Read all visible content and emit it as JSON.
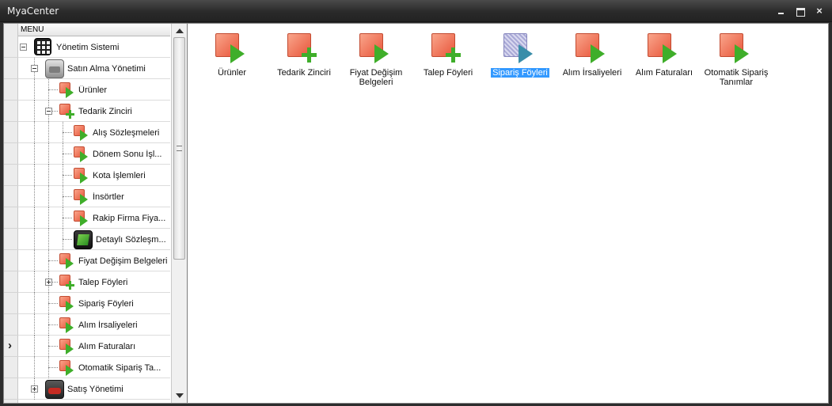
{
  "window": {
    "title": "MyaCenter",
    "minimize_label": "",
    "maximize_label": "",
    "close_label": "×"
  },
  "tree": {
    "header": "MENU",
    "active_row_index": 14,
    "rows": [
      {
        "label": "Yönetim Sistemi",
        "icon": "grid-app-icon"
      },
      {
        "label": "Satın Alma Yönetimi",
        "icon": "truck-app-icon"
      },
      {
        "label": "Ürünler",
        "icon": "document-play-icon"
      },
      {
        "label": "Tedarik Zinciri",
        "icon": "document-plus-icon"
      },
      {
        "label": "Alış Sözleşmeleri",
        "icon": "document-play-icon"
      },
      {
        "label": "Dönem Sonu İşl...",
        "icon": "document-play-icon"
      },
      {
        "label": "Kota İşlemleri",
        "icon": "document-play-icon"
      },
      {
        "label": "İnsörtler",
        "icon": "document-play-icon"
      },
      {
        "label": "Rakip Firma Fiya...",
        "icon": "document-play-icon"
      },
      {
        "label": "Detaylı Sözleşm...",
        "icon": "excel-app-icon"
      },
      {
        "label": "Fiyat Değişim Belgeleri",
        "icon": "document-play-icon"
      },
      {
        "label": "Talep Föyleri",
        "icon": "document-plus-icon"
      },
      {
        "label": "Sipariş Föyleri",
        "icon": "document-play-icon"
      },
      {
        "label": "Alım İrsaliyeleri",
        "icon": "document-play-icon"
      },
      {
        "label": "Alım Faturaları",
        "icon": "document-play-icon"
      },
      {
        "label": "Otomatik Sipariş Ta...",
        "icon": "document-play-icon"
      },
      {
        "label": "Satış Yönetimi",
        "icon": "car-app-icon"
      }
    ]
  },
  "tiles": [
    {
      "label": "Ürünler",
      "icon": "document-play-icon",
      "selected": false
    },
    {
      "label": "Tedarik Zinciri",
      "icon": "document-plus-icon",
      "selected": false
    },
    {
      "label": "Fiyat Değişim Belgeleri",
      "icon": "document-play-icon",
      "selected": false
    },
    {
      "label": "Talep Föyleri",
      "icon": "document-plus-icon",
      "selected": false
    },
    {
      "label": "Sipariş Föyleri",
      "icon": "document-play-icon",
      "selected": true
    },
    {
      "label": "Alım İrsaliyeleri",
      "icon": "document-play-icon",
      "selected": false
    },
    {
      "label": "Alım Faturaları",
      "icon": "document-play-icon",
      "selected": false
    },
    {
      "label": "Otomatik Sipariş Tanımlar",
      "icon": "document-play-icon",
      "selected": false
    }
  ],
  "colors": {
    "selection": "#3399ff",
    "accent_green": "#3fae2a",
    "accent_red": "#e8553a"
  }
}
